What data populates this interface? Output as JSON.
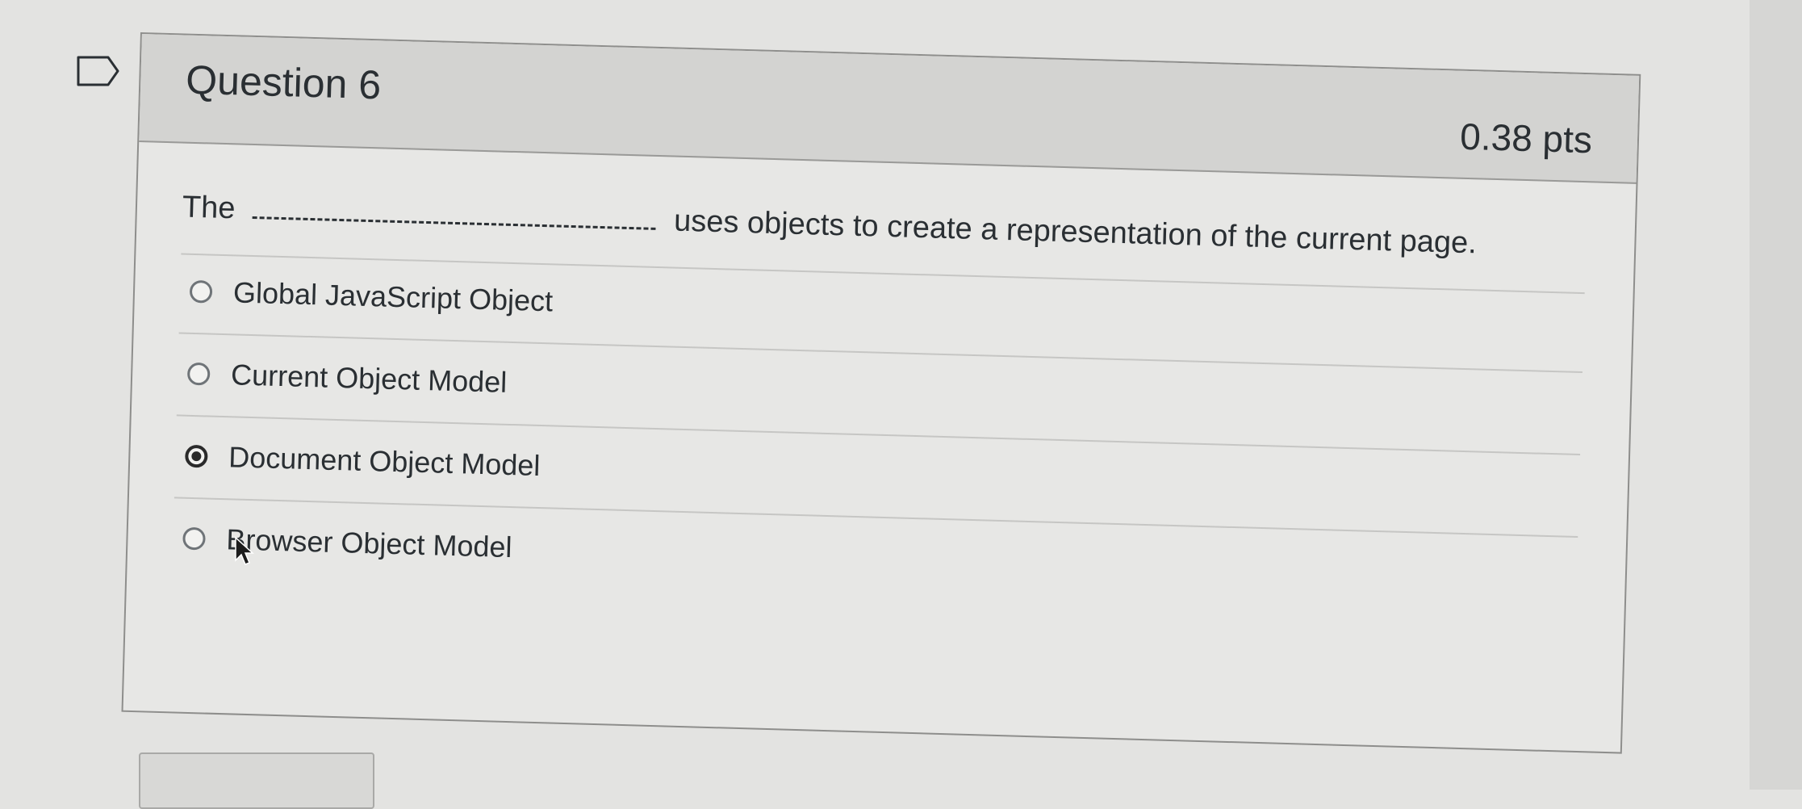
{
  "question": {
    "title": "Question 6",
    "points": "0.38 pts",
    "text_before": "The",
    "text_after": "uses objects to create a representation of the current page.",
    "flag_icon": "flag-outline-icon"
  },
  "answers": [
    {
      "label": "Global JavaScript Object",
      "selected": false
    },
    {
      "label": "Current Object Model",
      "selected": false
    },
    {
      "label": "Document Object Model",
      "selected": true
    },
    {
      "label": "Browser Object Model",
      "selected": false
    }
  ],
  "colors": {
    "header_bg": "#d3d3d1",
    "card_bg": "#e7e7e5",
    "text": "#2a2f33"
  }
}
